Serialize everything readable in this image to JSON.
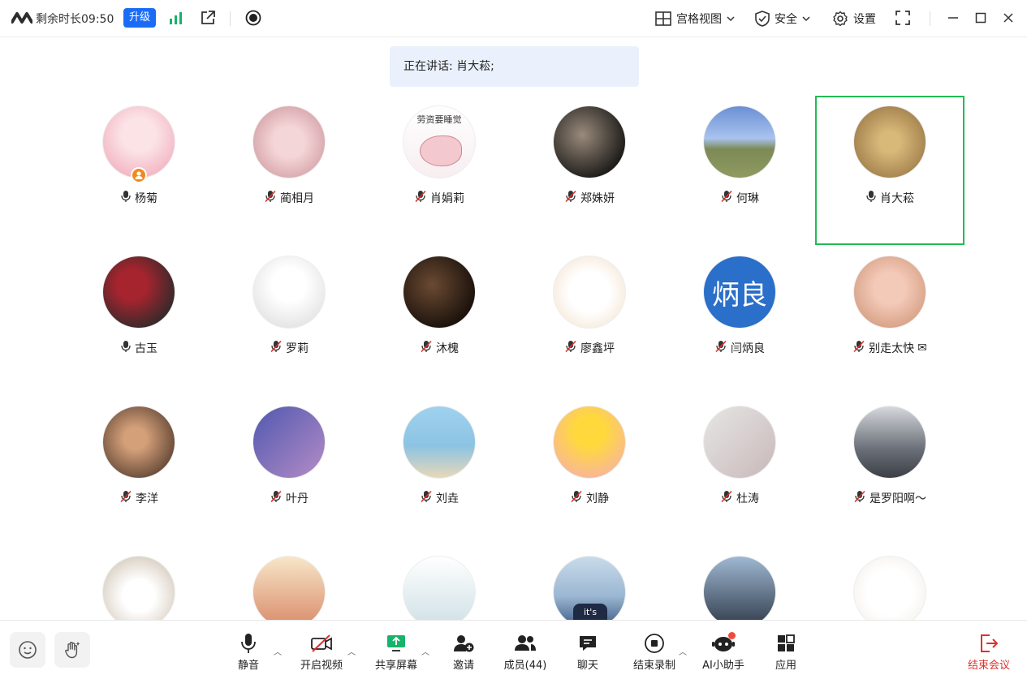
{
  "titlebar": {
    "remaining_time": "剩余时长09:50",
    "upgrade_label": "升级",
    "grid_view_label": "宫格视图",
    "security_label": "安全",
    "settings_label": "设置"
  },
  "speaking_banner": "正在讲话: 肖大菘;",
  "participants": [
    {
      "name": "杨菊",
      "mic": "on"
    },
    {
      "name": "蔺相月",
      "mic": "muted"
    },
    {
      "name": "肖娟莉",
      "mic": "muted"
    },
    {
      "name": "郑姝妍",
      "mic": "muted"
    },
    {
      "name": "何琳",
      "mic": "muted"
    },
    {
      "name": "肖大菘",
      "mic": "on"
    },
    {
      "name": "古玉",
      "mic": "on"
    },
    {
      "name": "罗莉",
      "mic": "muted"
    },
    {
      "name": "沐槐",
      "mic": "muted"
    },
    {
      "name": "廖鑫坪",
      "mic": "muted"
    },
    {
      "name": "闫炳良",
      "mic": "muted",
      "avatar_text": "炳良"
    },
    {
      "name": "别走太快",
      "mic": "muted",
      "extra": "✉"
    },
    {
      "name": "李洋",
      "mic": "muted"
    },
    {
      "name": "叶丹",
      "mic": "muted"
    },
    {
      "name": "刘垚",
      "mic": "muted"
    },
    {
      "name": "刘静",
      "mic": "muted"
    },
    {
      "name": "杜涛",
      "mic": "muted"
    },
    {
      "name": "是罗阳啊～",
      "mic": "muted"
    },
    {
      "name": "",
      "mic": "muted"
    },
    {
      "name": "",
      "mic": "muted"
    },
    {
      "name": "",
      "mic": "muted"
    },
    {
      "name": "",
      "mic": "muted"
    },
    {
      "name": "",
      "mic": "muted"
    },
    {
      "name": "",
      "mic": "muted"
    }
  ],
  "avatar_texts": {
    "p3_caption": "劳资要睡觉",
    "p10_text": "炳良",
    "p22_text": "it's"
  },
  "toolbar": {
    "mute_label": "静音",
    "video_label": "开启视频",
    "share_label": "共享屏幕",
    "invite_label": "邀请",
    "members_label": "成员(44)",
    "chat_label": "聊天",
    "record_label": "结束录制",
    "ai_label": "AI小助手",
    "apps_label": "应用",
    "end_label": "结束会议"
  },
  "colors": {
    "accent": "#1a6cf6",
    "active_speaker": "#22bb55",
    "end_red": "#e0302b",
    "banner_bg": "#eaf1fd"
  }
}
